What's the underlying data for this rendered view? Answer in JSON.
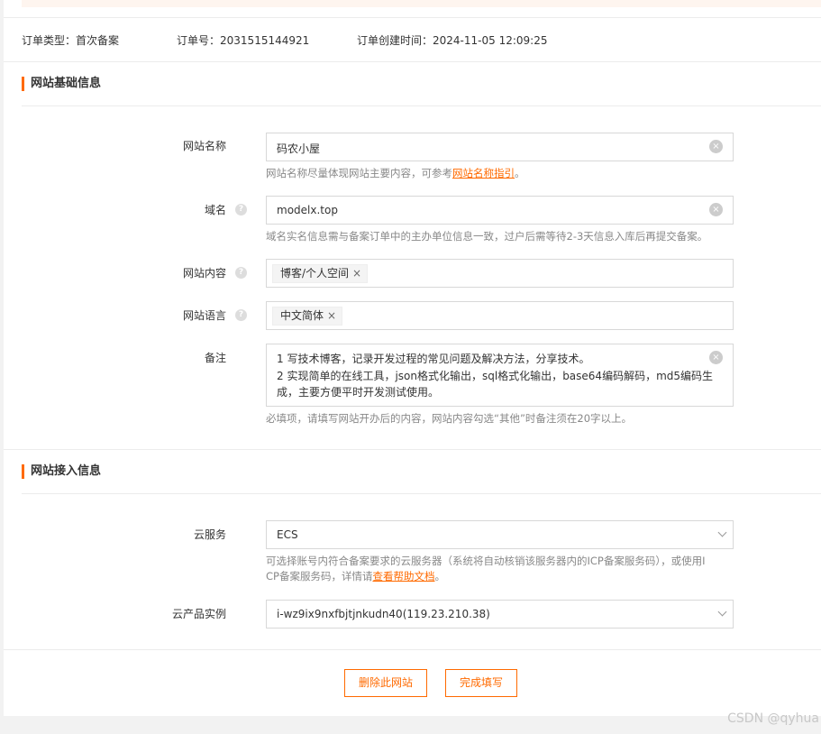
{
  "order": {
    "type_label": "订单类型：",
    "type_value": "首次备案",
    "number_label": "订单号：",
    "number_value": "2031515144921",
    "created_label": "订单创建时间：",
    "created_value": "2024-11-05 12:09:25"
  },
  "site_basic": {
    "title": "网站基础信息",
    "name_label": "网站名称",
    "name_value": "码农小屋",
    "name_hint_prefix": "网站名称尽量体现网站主要内容，可参考",
    "name_hint_link": "网站名称指引",
    "name_hint_suffix": "。",
    "domain_label": "域名",
    "domain_value": "modelx.top",
    "domain_hint": "域名实名信息需与备案订单中的主办单位信息一致，过户后需等待2-3天信息入库后再提交备案。",
    "content_label": "网站内容",
    "content_tag": "博客/个人空间",
    "language_label": "网站语言",
    "language_tag": "中文简体",
    "memo_label": "备注",
    "memo_line1": "1 写技术博客，记录开发过程的常见问题及解决方法，分享技术。",
    "memo_line2": "2 实现简单的在线工具，json格式化输出，sql格式化输出，base64编码解码，md5编码生",
    "memo_line3": "成，主要方便平时开发测试使用。",
    "memo_hint": "必填项，请填写网站开办后的内容，网站内容勾选“其他”时备注须在20字以上。"
  },
  "site_access": {
    "title": "网站接入信息",
    "cloud_label": "云服务",
    "cloud_value": "ECS",
    "cloud_hint_line1": "可选择账号内符合备案要求的云服务器（系统将自动核销该服务器内的ICP备案服务码），或使用I",
    "cloud_hint_line2_prefix": "CP备案服务码，详情请",
    "cloud_hint_link": "查看帮助文档",
    "cloud_hint_suffix": "。",
    "instance_label": "云产品实例",
    "instance_value": "i-wz9ix9nxfbjtjnkudn40(119.23.210.38)"
  },
  "actions": {
    "delete_label": "删除此网站",
    "finish_label": "完成填写"
  },
  "icons": {
    "help": "?",
    "clear": "×",
    "tag_remove": "×"
  },
  "watermark": "CSDN @qyhua",
  "colors": {
    "accent": "#ff6a00",
    "banner": "#fef5ef"
  }
}
